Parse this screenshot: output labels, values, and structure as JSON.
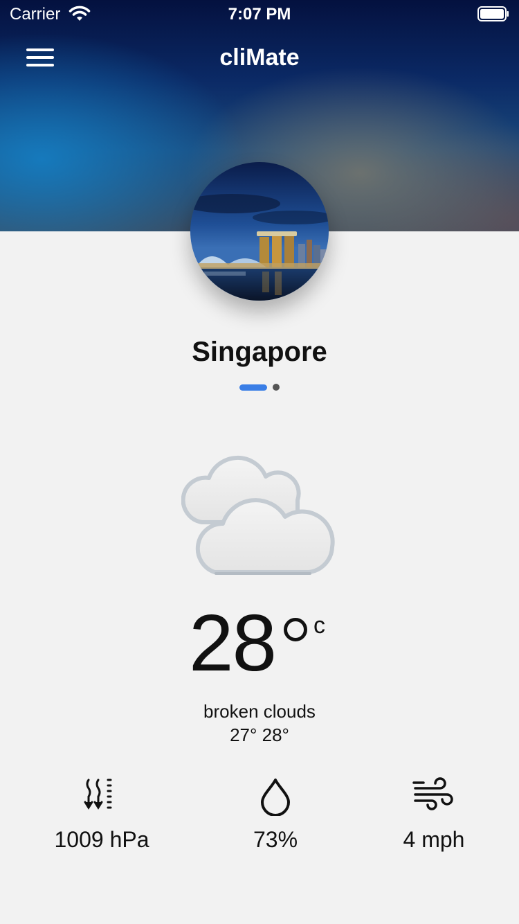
{
  "status_bar": {
    "carrier": "Carrier",
    "time": "7:07 PM"
  },
  "header": {
    "title": "cliMate",
    "menu_icon": "hamburger-menu-icon"
  },
  "location": {
    "city": "Singapore",
    "page_count": 2,
    "active_page": 1
  },
  "weather": {
    "icon": "broken-clouds-icon",
    "temperature": "28",
    "unit": "c",
    "description": "broken clouds",
    "range": "27° 28°"
  },
  "stats": {
    "pressure": {
      "icon": "pressure-icon",
      "value": "1009 hPa"
    },
    "humidity": {
      "icon": "humidity-drop-icon",
      "value": "73%"
    },
    "wind": {
      "icon": "wind-icon",
      "value": "4 mph"
    }
  },
  "colors": {
    "accent": "#3a7ee6",
    "background": "#f2f2f2"
  }
}
